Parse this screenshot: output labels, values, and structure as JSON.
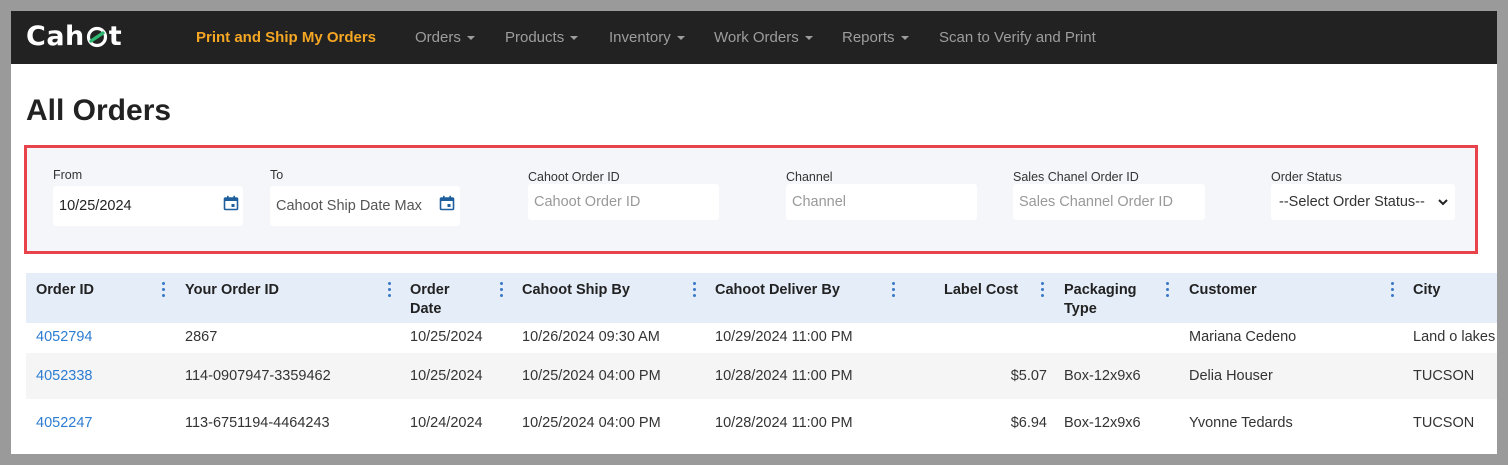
{
  "brand": {
    "logo_pre": "Cah",
    "logo_post": "t"
  },
  "nav": {
    "active": "Print and Ship My Orders",
    "items": [
      "Orders",
      "Products",
      "Inventory",
      "Work Orders",
      "Reports"
    ],
    "scan": "Scan to Verify and Print"
  },
  "page": {
    "title": "All Orders"
  },
  "filters": {
    "from_label": "From",
    "from_value": "10/25/2024",
    "to_label": "To",
    "to_placeholder": "Cahoot Ship Date Max",
    "order_id_label": "Cahoot Order ID",
    "order_id_placeholder": "Cahoot Order ID",
    "channel_label": "Channel",
    "channel_placeholder": "Channel",
    "sales_id_label": "Sales Chanel Order ID",
    "sales_id_placeholder": "Sales Channel Order ID",
    "status_label": "Order Status",
    "status_value": "--Select Order Status--"
  },
  "table": {
    "headers": [
      "Order ID",
      "Your Order ID",
      "Order Date",
      "Cahoot Ship By",
      "Cahoot Deliver By",
      "Label Cost",
      "Packaging Type",
      "Customer",
      "City"
    ],
    "rows": [
      [
        "4052794",
        "2867",
        "10/25/2024",
        "10/26/2024 09:30 AM",
        "10/29/2024 11:00 PM",
        "",
        "",
        "Mariana Cedeno",
        "Land o lakes"
      ],
      [
        "4052338",
        "114-0907947-3359462",
        "10/25/2024",
        "10/25/2024 04:00 PM",
        "10/28/2024 11:00 PM",
        "$5.07",
        "Box-12x9x6",
        "Delia Houser",
        "TUCSON"
      ],
      [
        "4052247",
        "113-6751194-4464243",
        "10/24/2024",
        "10/25/2024 04:00 PM",
        "10/28/2024 11:00 PM",
        "$6.94",
        "Box-12x9x6",
        "Yvonne Tedards",
        "TUCSON"
      ]
    ]
  },
  "colors": {
    "navbar": "#222222",
    "active": "#f5a623",
    "link": "#2c7cd1",
    "highlight": "#e8434a",
    "header_bg": "#e4edf8",
    "logo_ring": "#2eb872"
  },
  "icons": {
    "calendar": "calendar-icon",
    "kebab": "kebab-menu-icon",
    "chevron": "chevron-down-icon"
  }
}
